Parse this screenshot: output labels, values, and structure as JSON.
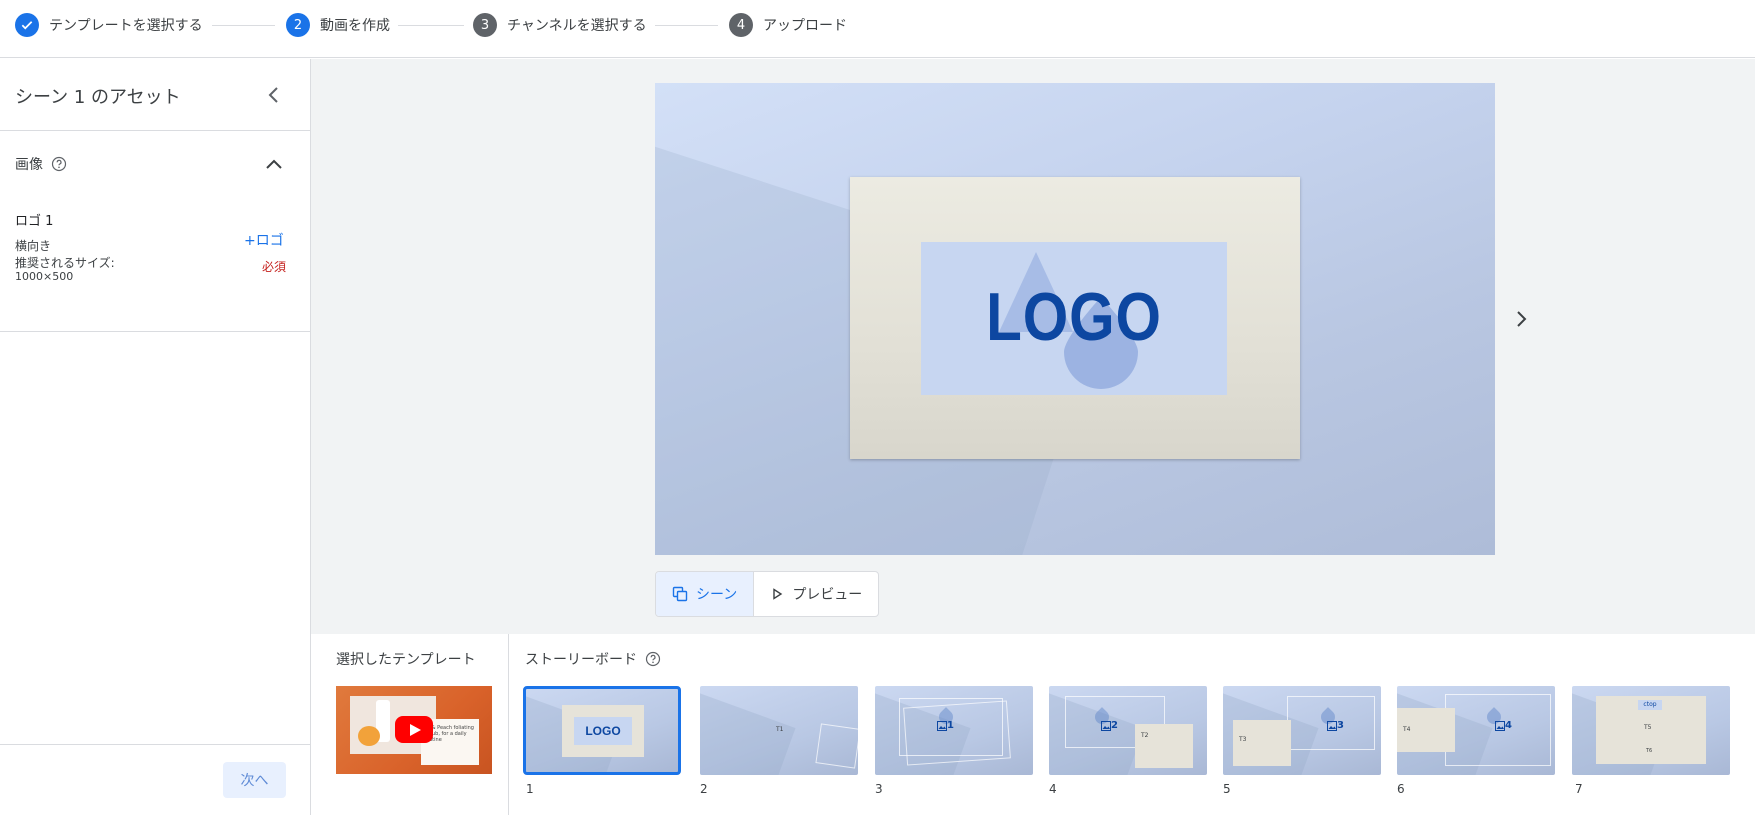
{
  "stepper": {
    "steps": [
      {
        "number": "",
        "label": "テンプレートを選択する",
        "state": "done"
      },
      {
        "number": "2",
        "label": "動画を作成",
        "state": "active"
      },
      {
        "number": "3",
        "label": "チャンネルを選択する",
        "state": "todo"
      },
      {
        "number": "4",
        "label": "アップロード",
        "state": "todo"
      }
    ]
  },
  "left_panel": {
    "title": "シーン 1 のアセット",
    "section": {
      "label": "画像",
      "asset": {
        "name": "ロゴ 1",
        "orientation": "横向き",
        "size_label": "推奨されるサイズ:",
        "size": "1000×500",
        "add_label": "+ロゴ",
        "required_label": "必須"
      }
    },
    "next_label": "次へ"
  },
  "canvas": {
    "logo_text": "LOGO"
  },
  "view_toggle": {
    "scene_label": "シーン",
    "preview_label": "プレビュー"
  },
  "template_section": {
    "title": "選択したテンプレート",
    "thumb_text": "ey & Peach foliating Scrub, for a daily routine"
  },
  "storyboard": {
    "title": "ストーリーボード",
    "scenes": [
      {
        "number": "1",
        "content": "LOGO"
      },
      {
        "number": "2",
        "content": "T1"
      },
      {
        "number": "3",
        "content": "1"
      },
      {
        "number": "4",
        "content": "2",
        "extra": "T2"
      },
      {
        "number": "5",
        "content": "3",
        "extra": "T3"
      },
      {
        "number": "6",
        "content": "4",
        "extra": "T4"
      },
      {
        "number": "7",
        "content": "T5",
        "extra": "T6",
        "tag": "ctop"
      }
    ]
  },
  "colors": {
    "accent": "#1a73e8",
    "required": "#c5221f",
    "logo": "#0d47a1"
  }
}
